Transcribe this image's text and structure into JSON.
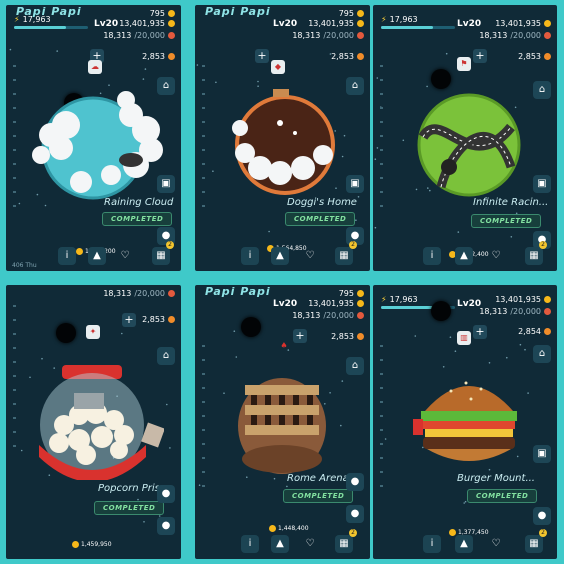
{
  "panels": [
    {
      "brand": "Papi Papi",
      "energy": "17,963",
      "level": "Lv20",
      "coins": "795",
      "gold": "13,401,935",
      "tomato_frac": "18,313",
      "tomato_max": "/20,000",
      "stars": "2,853",
      "planet_name": "Raining Cloud",
      "completed_label": "COMPLETED",
      "coin_count": "1,566,200",
      "bottom_small": "406 Thu",
      "badge": "2"
    },
    {
      "brand": "Papi Papi",
      "energy": "",
      "level": "Lv20",
      "coins": "795",
      "gold": "13,401,935",
      "tomato_frac": "18,313",
      "tomato_max": "/20,000",
      "stars": "2,853",
      "planet_name": "Doggi's Home",
      "completed_label": "COMPLETED",
      "coin_count": "1,564,850",
      "bottom_small": "",
      "badge": "2"
    },
    {
      "brand": "",
      "energy": "17,963",
      "level": "Lv20",
      "coins": "",
      "gold": "13,401,935",
      "tomato_frac": "18,313",
      "tomato_max": "/20,000",
      "stars": "2,853",
      "planet_name": "Infinite Racin...",
      "completed_label": "COMPLETED",
      "coin_count": "1,502,400",
      "bottom_small": "",
      "badge": "2"
    },
    {
      "brand": "",
      "energy": "",
      "level": "",
      "coins": "",
      "gold": "",
      "tomato_frac": "18,313",
      "tomato_max": "/20,000",
      "stars": "2,853",
      "planet_name": "Popcorn Priso",
      "completed_label": "COMPLETED",
      "coin_count": "1,459,950",
      "bottom_small": "",
      "badge": ""
    },
    {
      "brand": "Papi Papi",
      "energy": "",
      "level": "Lv20",
      "coins": "795",
      "gold": "13,401,935",
      "tomato_frac": "18,313",
      "tomato_max": "/20,000",
      "stars": "2,853",
      "planet_name": "Rome Arena",
      "completed_label": "COMPLETED",
      "coin_count": "1,448,400",
      "bottom_small": "",
      "badge": "2"
    },
    {
      "brand": "",
      "energy": "17,963",
      "level": "Lv20",
      "coins": "",
      "gold": "13,401,935",
      "tomato_frac": "18,313",
      "tomato_max": "/20,000",
      "stars": "2,854",
      "planet_name": "Burger Mount...",
      "completed_label": "COMPLETED",
      "coin_count": "1,377,450",
      "bottom_small": "",
      "badge": "2"
    }
  ],
  "colors": {
    "bg": "#3fc9c9",
    "panel": "#102a37",
    "accent": "#82e0a0"
  }
}
